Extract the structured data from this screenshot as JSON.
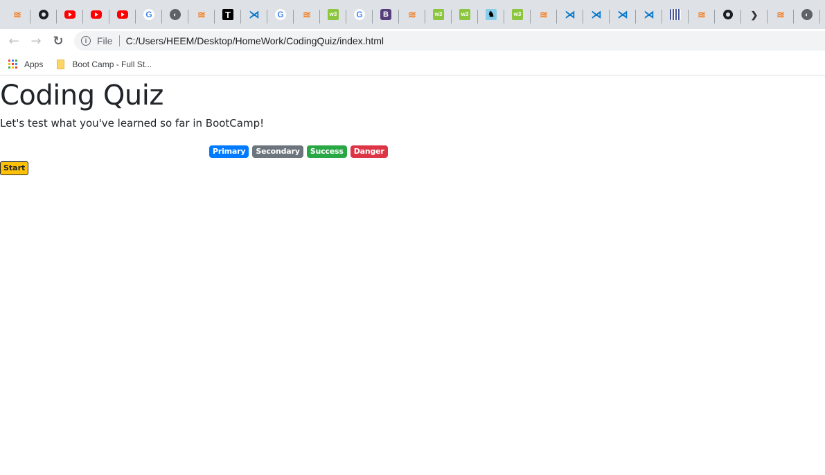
{
  "browser": {
    "tabs": [
      {
        "icon": "stackoverflow-icon",
        "glyph": "≋"
      },
      {
        "icon": "github-icon",
        "glyph": ""
      },
      {
        "icon": "youtube-icon",
        "glyph": ""
      },
      {
        "icon": "youtube-icon",
        "glyph": ""
      },
      {
        "icon": "youtube-icon",
        "glyph": ""
      },
      {
        "icon": "google-icon",
        "glyph": "G"
      },
      {
        "icon": "globe-icon",
        "glyph": "◐"
      },
      {
        "icon": "stackoverflow-icon",
        "glyph": "≋"
      },
      {
        "icon": "typora-icon",
        "glyph": "T"
      },
      {
        "icon": "vscode-icon",
        "glyph": "⋊"
      },
      {
        "icon": "google-icon",
        "glyph": "G"
      },
      {
        "icon": "stackoverflow-icon",
        "glyph": "≋"
      },
      {
        "icon": "w3schools-icon",
        "glyph": "w3"
      },
      {
        "icon": "google-icon",
        "glyph": "G"
      },
      {
        "icon": "bootstrap-icon",
        "glyph": "B"
      },
      {
        "icon": "stackoverflow-icon",
        "glyph": "≋"
      },
      {
        "icon": "w3schools-icon",
        "glyph": "w3"
      },
      {
        "icon": "w3schools-icon",
        "glyph": "w3"
      },
      {
        "icon": "dog-icon",
        "glyph": "♞"
      },
      {
        "icon": "w3schools-icon",
        "glyph": "w3"
      },
      {
        "icon": "stackoverflow-icon",
        "glyph": "≋"
      },
      {
        "icon": "vscode-icon",
        "glyph": "⋊"
      },
      {
        "icon": "vscode-icon",
        "glyph": "⋊"
      },
      {
        "icon": "vscode-icon",
        "glyph": "⋊"
      },
      {
        "icon": "vscode-icon",
        "glyph": "⋊"
      },
      {
        "icon": "grid-site-icon",
        "glyph": ""
      },
      {
        "icon": "stackoverflow-icon",
        "glyph": "≋"
      },
      {
        "icon": "github-icon",
        "glyph": ""
      },
      {
        "icon": "sourcetree-icon",
        "glyph": "❯"
      },
      {
        "icon": "stackoverflow-icon",
        "glyph": "≋"
      },
      {
        "icon": "globe-icon",
        "glyph": "◐"
      }
    ],
    "nav": {
      "back": "←",
      "forward": "→",
      "reload": "↻"
    },
    "address": {
      "info_glyph": "i",
      "scheme_label": "File",
      "url": "C:/Users/HEEM/Desktop/HomeWork/CodingQuiz/index.html"
    },
    "bookmarks": [
      {
        "label": "Apps",
        "icon": "apps-grid-icon"
      },
      {
        "label": "Boot Camp - Full St...",
        "icon": "folder-icon"
      }
    ],
    "apps_colors": [
      "#ea4335",
      "#4285f4",
      "#34a853",
      "#fbbc05",
      "#ea4335",
      "#4285f4",
      "#34a853",
      "#fbbc05",
      "#ea4335"
    ]
  },
  "page": {
    "title": "Coding Quiz",
    "lead": "Let's test what you've learned so far in BootCamp!",
    "badges": [
      {
        "label": "Primary",
        "color": "#007bff"
      },
      {
        "label": "Secondary",
        "color": "#6c757d"
      },
      {
        "label": "Success",
        "color": "#28a745"
      },
      {
        "label": "Danger",
        "color": "#dc3545"
      }
    ],
    "start_button": {
      "label": "Start",
      "color": "#ffc107"
    }
  }
}
